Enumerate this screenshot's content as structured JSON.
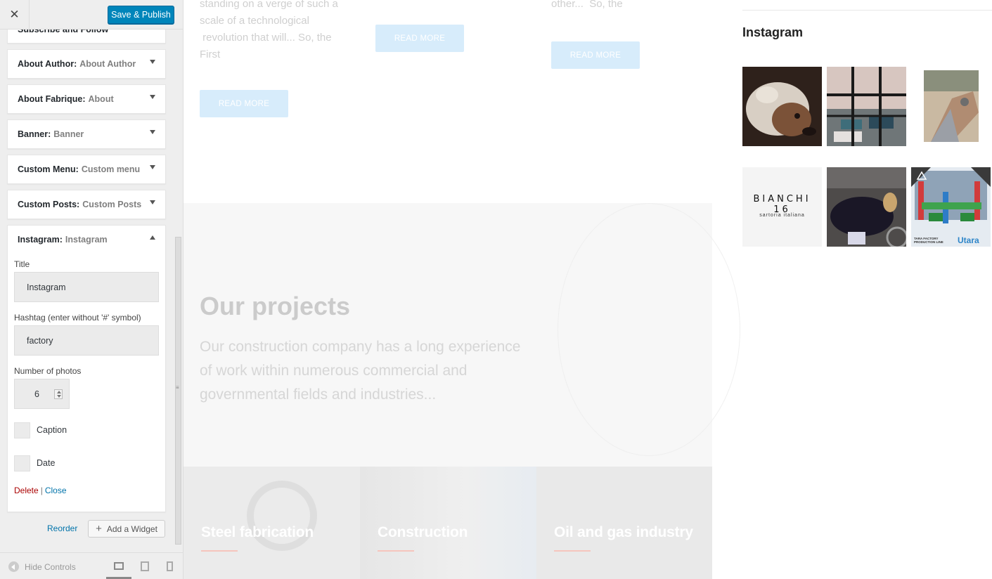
{
  "header": {
    "close_icon": "close-icon",
    "save_label": "Save & Publish"
  },
  "widgets": [
    {
      "type": "Subscribe and Follow",
      "name": ""
    },
    {
      "type": "About Author:",
      "name": "About Author"
    },
    {
      "type": "About Fabrique:",
      "name": "About"
    },
    {
      "type": "Banner:",
      "name": "Banner"
    },
    {
      "type": "Custom Menu:",
      "name": "Custom menu"
    },
    {
      "type": "Custom Posts:",
      "name": "Custom Posts"
    },
    {
      "type": "Instagram:",
      "name": "Instagram"
    }
  ],
  "instagram_form": {
    "title_label": "Title",
    "title_value": "Instagram",
    "hashtag_label": "Hashtag (enter without '#' symbol)",
    "hashtag_value": "factory",
    "photos_label": "Number of photos",
    "photos_value": "6",
    "caption_label": "Caption",
    "date_label": "Date",
    "delete_label": "Delete",
    "separator": "|",
    "close_label": "Close"
  },
  "footer": {
    "reorder_label": "Reorder",
    "add_widget_label": "Add a Widget",
    "hide_controls_label": "Hide Controls"
  },
  "preview": {
    "post1_text": [
      "standing on a verge of such a",
      "scale of a technological",
      " revolution that will... So, the",
      "First"
    ],
    "post3_text": [
      "other...  So, the"
    ],
    "read_more": "READ MORE",
    "projects_title": "Our projects",
    "projects_desc": "Our construction company has a long experience of work within numerous commercial and governmental fields and industries...",
    "tiles": [
      "Steel fabrication",
      "Construction",
      "Oil and gas industry"
    ]
  },
  "instagram_widget": {
    "title": "Instagram",
    "photo_texts": {
      "bianchi": "BIANCHI 16",
      "bianchi_sub": "sartoria italiana",
      "tara": "TARA FACTORY PRODUCTION LINE",
      "tara_logo": "Utara"
    }
  },
  "colors": {
    "accent": "#0085ba",
    "link": "#0073aa",
    "delete": "#a00",
    "read_more_bg": "#d7ecfb"
  }
}
